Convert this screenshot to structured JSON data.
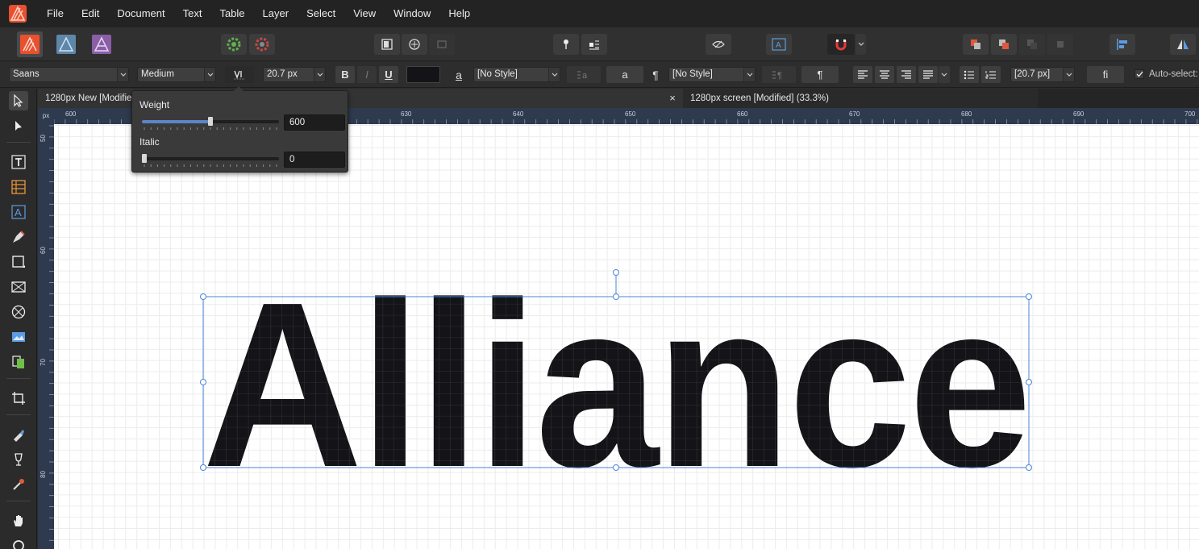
{
  "menu": [
    "File",
    "Edit",
    "Document",
    "Text",
    "Table",
    "Layer",
    "Select",
    "View",
    "Window",
    "Help"
  ],
  "context": {
    "font_family": "Saans",
    "font_style": "Medium",
    "font_size": "20.7 px",
    "char_style_glyph": "a",
    "char_style": "[No Style]",
    "char_btn": "a",
    "para_glyph": "¶",
    "para_style": "[No Style]",
    "para_btn": "¶",
    "leading": "[20.7 px]",
    "ligature_btn": "fi",
    "auto_select_label": "Auto-select:",
    "bold_label": "B",
    "italic_label": "I",
    "underline_label": "U"
  },
  "tabs": {
    "doc1": "1280px New [Modified]",
    "doc2": "1280px screen [Modified] (33.3%)",
    "close_glyph": "×"
  },
  "ruler": {
    "unit": "px",
    "h_labels": [
      "600",
      "630",
      "640",
      "650",
      "660",
      "670",
      "680",
      "690",
      "700"
    ],
    "v_labels": [
      "50",
      "60",
      "70",
      "80"
    ]
  },
  "canvas_text": "Alliance",
  "popup": {
    "weight_label": "Weight",
    "weight_value": "600",
    "weight_fraction": 0.5,
    "italic_label": "Italic",
    "italic_value": "0",
    "italic_fraction": 0
  },
  "colors": {
    "accent": "#5b86c6",
    "text_fill": "#141418",
    "selection": "#4a86d8"
  }
}
